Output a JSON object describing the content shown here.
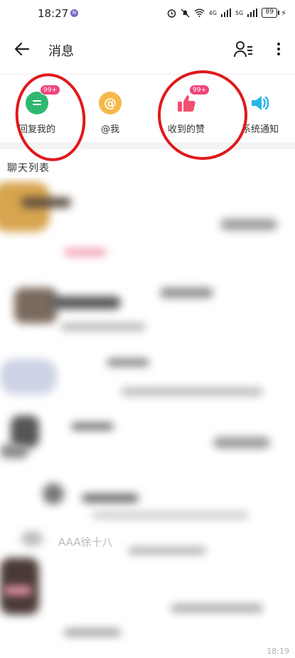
{
  "status_bar": {
    "time": "18:27",
    "network_left": "4G",
    "network_right": "5G",
    "battery": "89"
  },
  "header": {
    "title": "消息"
  },
  "categories": [
    {
      "label": "回复我的",
      "badge": "99+",
      "icon": "chat-bubble-icon",
      "color": "#2fb86e"
    },
    {
      "label": "@我",
      "badge": "",
      "icon": "at-icon",
      "color": "#f5b94a"
    },
    {
      "label": "收到的赞",
      "badge": "99+",
      "icon": "thumbs-up-icon",
      "color": "#f05070"
    },
    {
      "label": "系统通知",
      "badge": "",
      "icon": "speaker-icon",
      "color": "#27b6e6"
    }
  ],
  "section_title": "聊天列表",
  "chat_list": [
    {
      "name": "",
      "time": ""
    },
    {
      "name": "",
      "time": ""
    },
    {
      "name": "",
      "time": ""
    },
    {
      "name": "",
      "time": ""
    },
    {
      "name": "",
      "time": ""
    },
    {
      "name": "AAA徐十八",
      "time": ""
    },
    {
      "name": "",
      "time": "18:19"
    }
  ],
  "colors": {
    "annotation": "#e0191c",
    "badge": "#f0447a"
  }
}
